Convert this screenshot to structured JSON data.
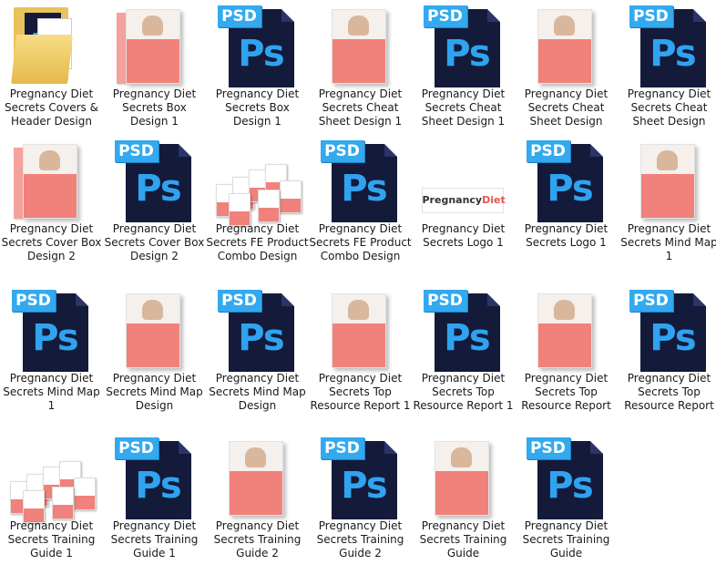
{
  "window": {
    "view": "large-icons"
  },
  "items": [
    {
      "label": "Pregnancy Diet Secrets Covers & Header Design",
      "type": "folder",
      "icon": "folder-icon"
    },
    {
      "label": "Pregnancy Diet Secrets Box Design 1",
      "type": "box",
      "icon": "box-cover-thumbnail"
    },
    {
      "label": "Pregnancy Diet Secrets Box Design 1",
      "type": "psd",
      "icon": "psd-file-icon"
    },
    {
      "label": "Pregnancy Diet Secrets Cheat Sheet Design 1",
      "type": "book",
      "icon": "cheat-sheet-thumbnail"
    },
    {
      "label": "Pregnancy Diet Secrets Cheat Sheet Design 1",
      "type": "psd",
      "icon": "psd-file-icon"
    },
    {
      "label": "Pregnancy Diet Secrets Cheat Sheet Design",
      "type": "book",
      "icon": "cheat-sheet-thumbnail"
    },
    {
      "label": "Pregnancy Diet Secrets Cheat Sheet Design",
      "type": "psd",
      "icon": "psd-file-icon"
    },
    {
      "label": "Pregnancy Diet Secrets Cover Box Design 2",
      "type": "box",
      "icon": "cover-box-thumbnail"
    },
    {
      "label": "Pregnancy Diet Secrets Cover Box Design 2",
      "type": "psd",
      "icon": "psd-file-icon"
    },
    {
      "label": "Pregnancy Diet Secrets FE Product Combo Design",
      "type": "combo",
      "icon": "product-combo-thumbnail"
    },
    {
      "label": "Pregnancy Diet Secrets FE Product Combo Design",
      "type": "psd",
      "icon": "psd-file-icon"
    },
    {
      "label": "Pregnancy Diet Secrets Logo 1",
      "type": "logo",
      "icon": "logo-thumbnail",
      "logo_text": "Pregnancy",
      "logo_accent": "Diet"
    },
    {
      "label": "Pregnancy Diet Secrets Logo 1",
      "type": "psd",
      "icon": "psd-file-icon"
    },
    {
      "label": "Pregnancy Diet Secrets Mind Map 1",
      "type": "book",
      "icon": "mind-map-thumbnail"
    },
    {
      "label": "Pregnancy Diet Secrets Mind Map 1",
      "type": "psd",
      "icon": "psd-file-icon"
    },
    {
      "label": "Pregnancy Diet Secrets Mind Map Design",
      "type": "book",
      "icon": "mind-map-thumbnail"
    },
    {
      "label": "Pregnancy Diet Secrets Mind Map Design",
      "type": "psd",
      "icon": "psd-file-icon"
    },
    {
      "label": "Pregnancy Diet Secrets Top Resource Report 1",
      "type": "book",
      "icon": "report-thumbnail"
    },
    {
      "label": "Pregnancy Diet Secrets Top Resource Report 1",
      "type": "psd",
      "icon": "psd-file-icon"
    },
    {
      "label": "Pregnancy Diet Secrets Top Resource Report",
      "type": "book",
      "icon": "report-thumbnail"
    },
    {
      "label": "Pregnancy Diet Secrets Top Resource Report",
      "type": "psd",
      "icon": "psd-file-icon"
    },
    {
      "label": "Pregnancy Diet Secrets Training Guide 1",
      "type": "combo",
      "icon": "training-guide-thumbnail"
    },
    {
      "label": "Pregnancy Diet Secrets Training Guide 1",
      "type": "psd",
      "icon": "psd-file-icon"
    },
    {
      "label": "Pregnancy Diet Secrets Training Guide 2",
      "type": "book",
      "icon": "training-guide-thumbnail"
    },
    {
      "label": "Pregnancy Diet Secrets Training Guide 2",
      "type": "psd",
      "icon": "psd-file-icon"
    },
    {
      "label": "Pregnancy Diet Secrets Training Guide",
      "type": "book",
      "icon": "training-guide-thumbnail"
    },
    {
      "label": "Pregnancy Diet Secrets Training Guide",
      "type": "psd",
      "icon": "psd-file-icon"
    }
  ],
  "psd_tag": "PSD",
  "ps_text": "Ps",
  "colors": {
    "psd_blue": "#33a9ef",
    "psd_dark": "#141a3a",
    "cover_pink": "#f1817b",
    "folder": "#e8c25a"
  }
}
